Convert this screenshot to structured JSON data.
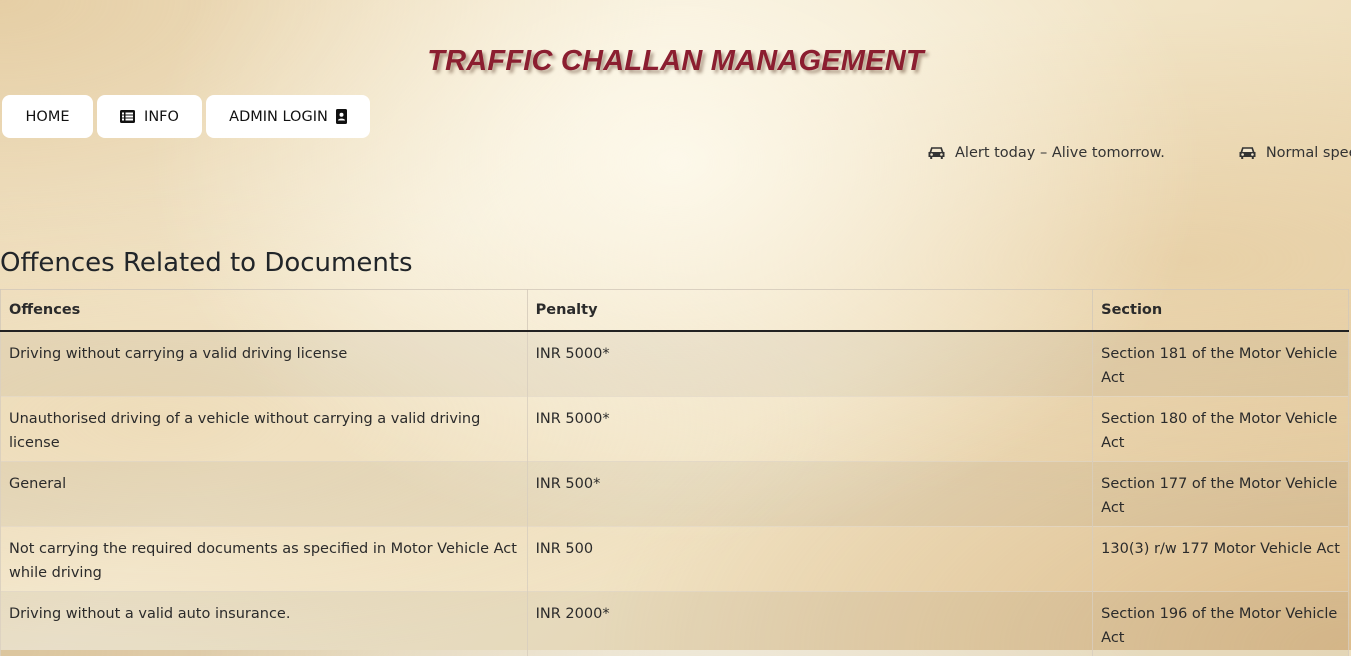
{
  "header": {
    "title": "TRAFFIC CHALLAN MANAGEMENT"
  },
  "nav": {
    "home": "HOME",
    "info": "INFO",
    "admin": "ADMIN LOGIN",
    "info_icon": "list-icon",
    "admin_icon": "contact-card-icon"
  },
  "marquee": {
    "icon": "car-icon",
    "items": [
      "Alert today – Alive tomorrow.",
      "Normal spee"
    ]
  },
  "main": {
    "heading": "Offences Related to Documents",
    "columns": [
      "Offences",
      "Penalty",
      "Section"
    ],
    "rows": [
      {
        "offence": "Driving without carrying a valid driving license",
        "penalty": "INR 5000*",
        "section": "Section 181 of the Motor Vehicle Act"
      },
      {
        "offence": "Unauthorised driving of a vehicle without carrying a valid driving license",
        "penalty": "INR 5000*",
        "section": "Section 180 of the Motor Vehicle Act"
      },
      {
        "offence": "General",
        "penalty": "INR 500*",
        "section": "Section 177 of the Motor Vehicle Act"
      },
      {
        "offence": "Not carrying the required documents as specified in Motor Vehicle Act while driving",
        "penalty": "INR 500",
        "section": "130(3) r/w 177 Motor Vehicle Act"
      },
      {
        "offence": "Driving without a valid auto insurance.",
        "penalty": "INR 2000*",
        "section": "Section 196 of the Motor Vehicle Act"
      }
    ]
  },
  "colors": {
    "title": "#8b1e30",
    "button_bg": "#ffffff"
  }
}
